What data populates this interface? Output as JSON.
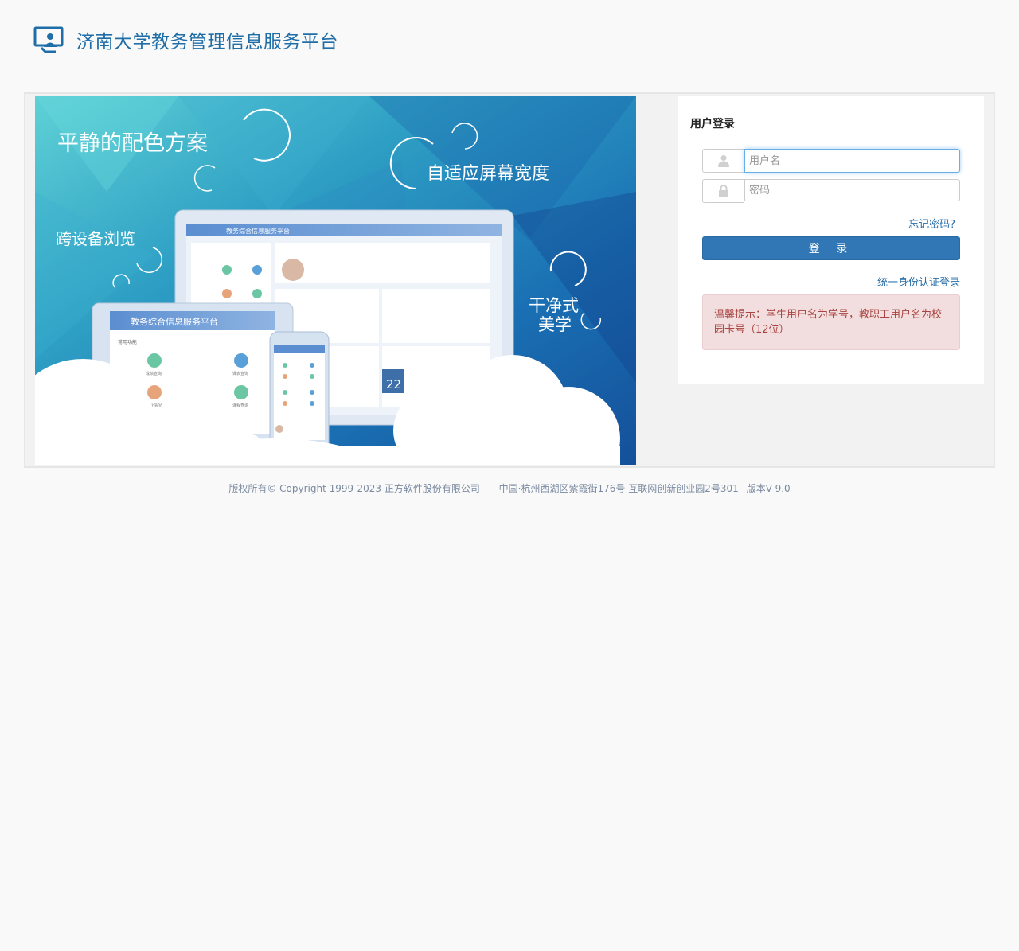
{
  "header": {
    "logo_icon": "monitor-user-icon",
    "title": "济南大学教务管理信息服务平台",
    "brand_color": "#1f6ea8"
  },
  "banner": {
    "slogan_1": "平静的配色方案",
    "slogan_2": "自适应屏幕宽度",
    "slogan_3": "跨设备浏览",
    "slogan_4_line1": "干净式",
    "slogan_4_line2": "美学",
    "screen_title_laptop": "教务综合信息服务平台",
    "screen_title_tablet": "教务综合信息服务平台",
    "tablet_section": "常用功能",
    "tablet_tiles": [
      "成绩查询",
      "课表查询",
      "学业情况",
      "课程查询"
    ],
    "calendar_day": "22"
  },
  "login": {
    "title": "用户登录",
    "username_placeholder": "用户名",
    "password_placeholder": "密码",
    "username_icon": "user-icon",
    "password_icon": "lock-icon",
    "forgot_label": "忘记密码?",
    "submit_label": "登 录",
    "sso_label": "统一身份认证登录",
    "notice_text": "温馨提示：学生用户名为学号，教职工用户名为校园卡号（12位）",
    "accent_color": "#3277b5"
  },
  "footer": {
    "copyright": "版权所有© Copyright 1999-2023 正方软件股份有限公司",
    "address": "中国·杭州西湖区紫霞街176号 互联网创新创业园2号301",
    "version": "版本V-9.0"
  }
}
